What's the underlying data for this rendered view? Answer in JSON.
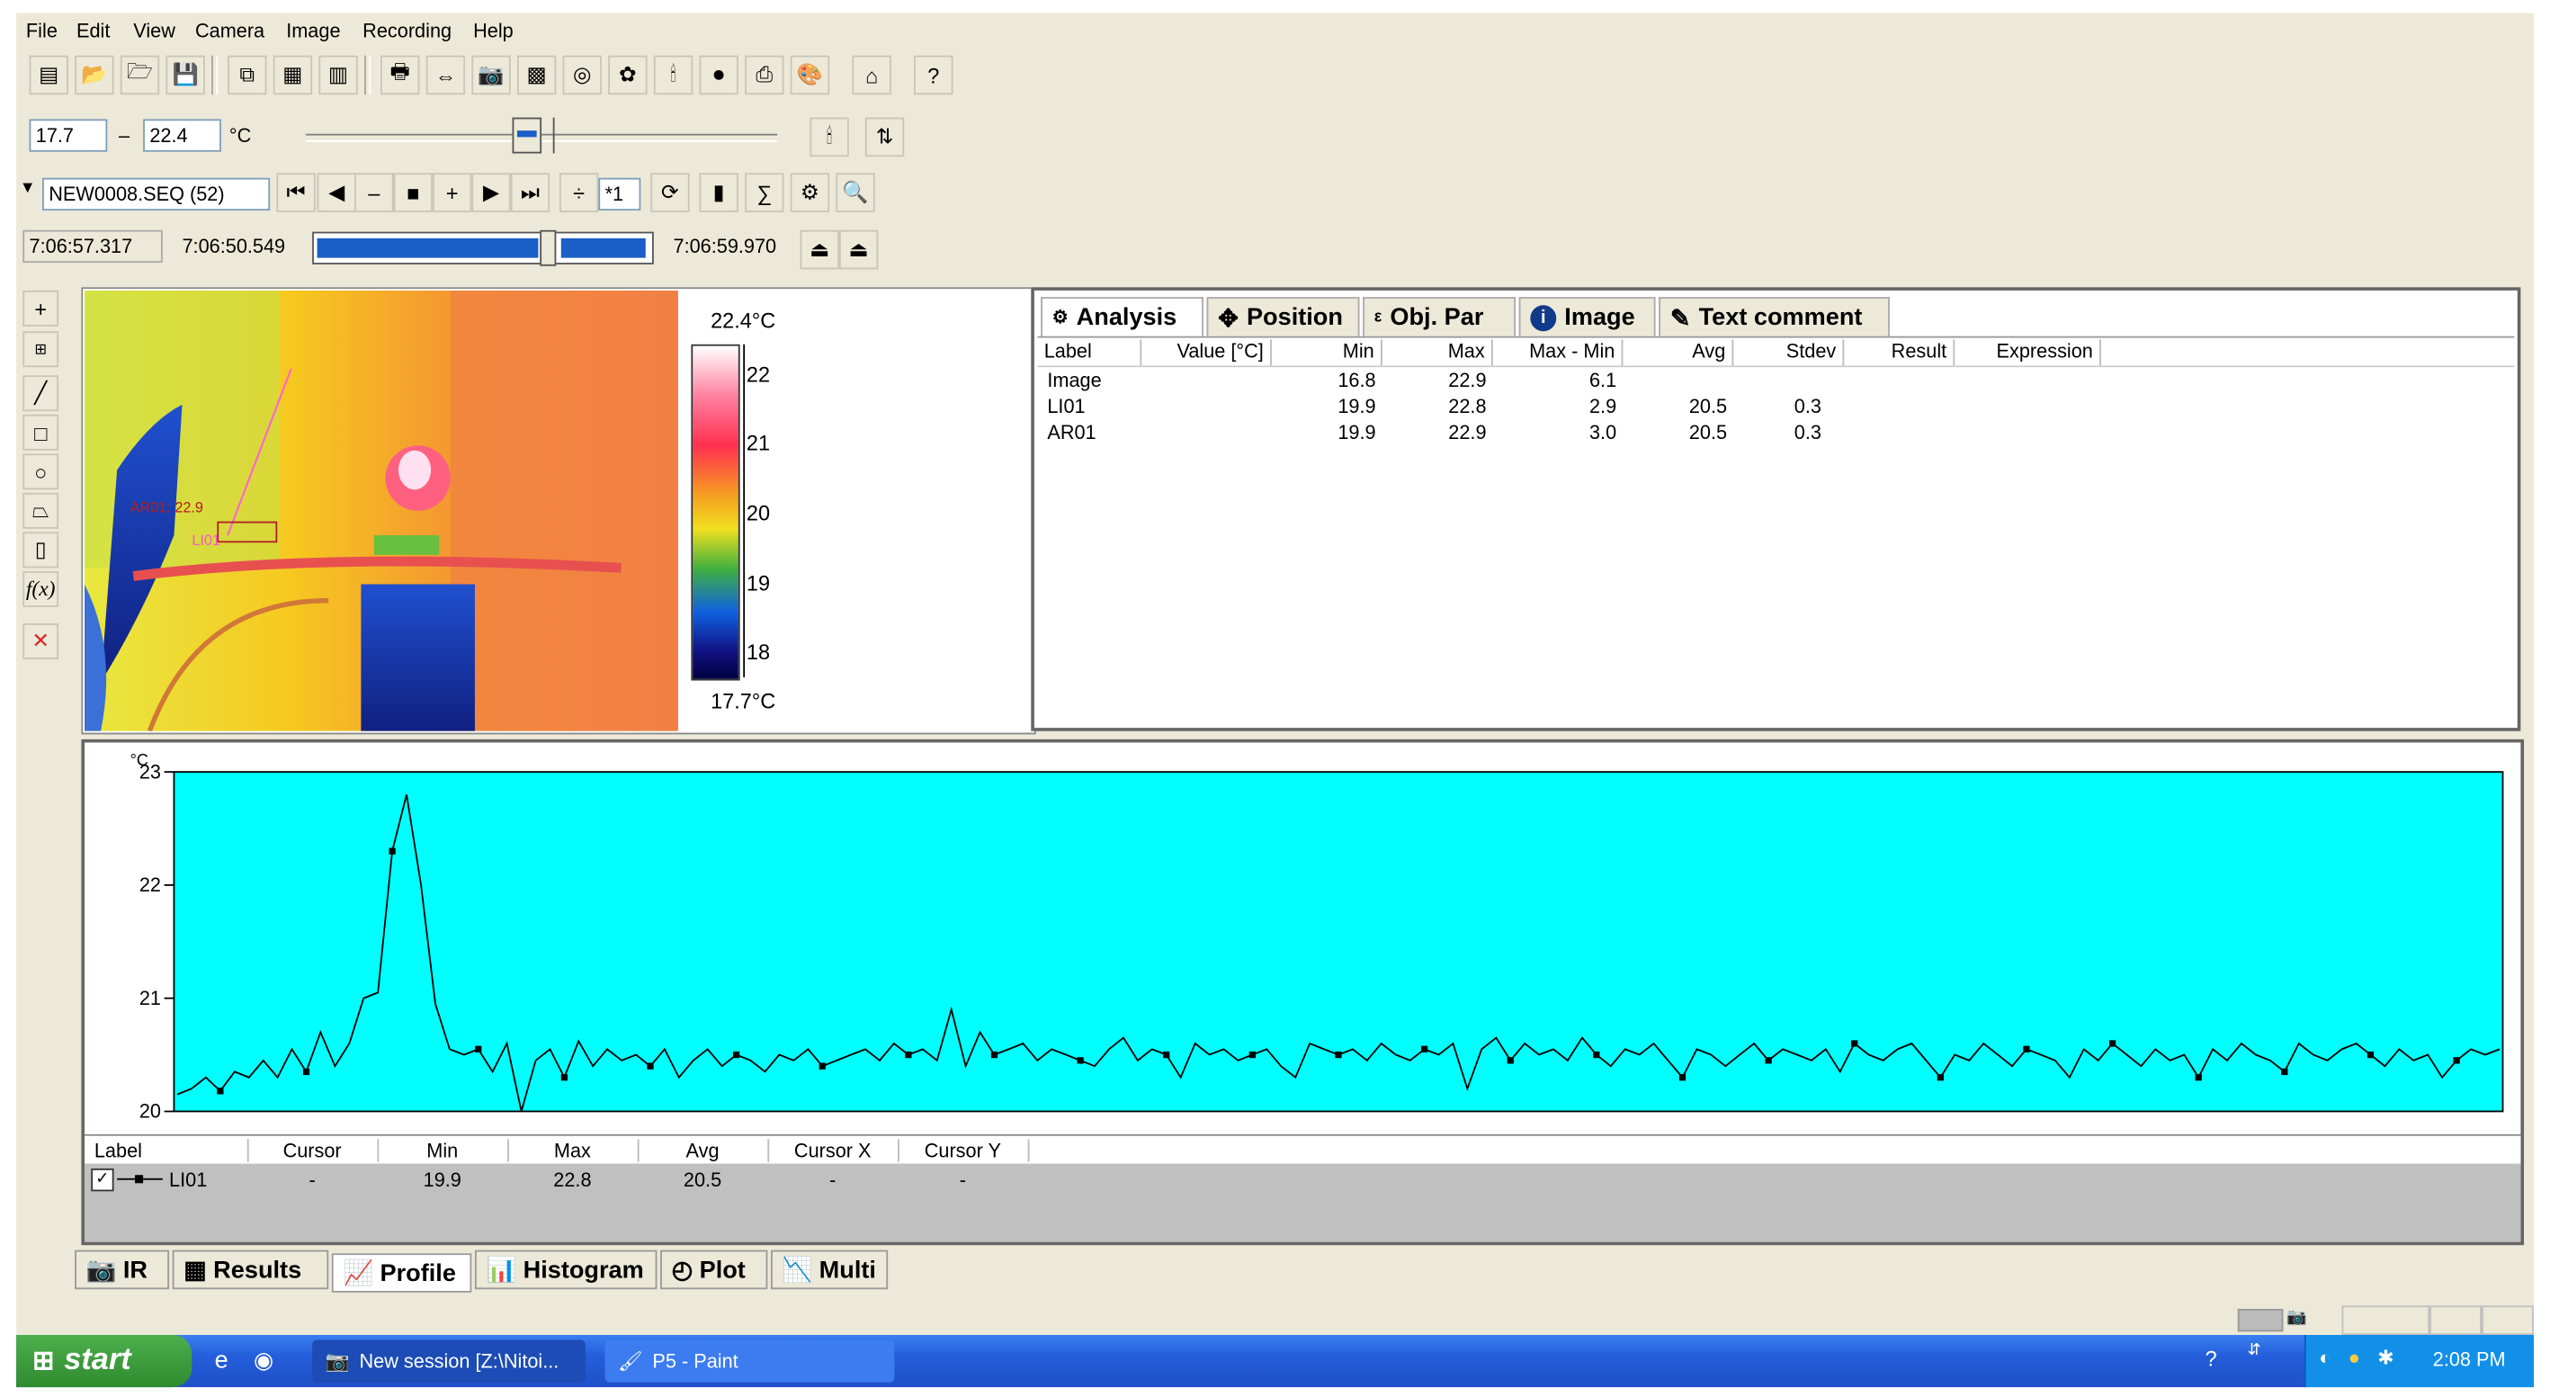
{
  "menu": [
    "File",
    "Edit",
    "View",
    "Camera",
    "Image",
    "Recording",
    "Help"
  ],
  "range": {
    "low": "17.7",
    "dash": "–",
    "high": "22.4",
    "unit": "°C"
  },
  "sequence": {
    "file": "NEW0008.SEQ (52)",
    "speed": "*1"
  },
  "time": {
    "start": "7:06:57.317",
    "current": "7:06:50.549",
    "end": "7:06:59.970"
  },
  "scale": {
    "top_label": "22.4°C",
    "bottom_label": "17.7°C",
    "ticks": [
      "22",
      "21",
      "20",
      "19",
      "18"
    ]
  },
  "ir_overlay": {
    "area_label": "AR01: 22.9",
    "line_label": "LI01"
  },
  "analysis": {
    "tabs": [
      "Analysis",
      "Position",
      "Obj. Par",
      "Image",
      "Text comment"
    ],
    "columns": [
      "Label",
      "Value [°C]",
      "Min",
      "Max",
      "Max - Min",
      "Avg",
      "Stdev",
      "Result",
      "Expression"
    ],
    "rows": [
      {
        "label": "Image",
        "min": "16.8",
        "max": "22.9",
        "range": "6.1",
        "avg": "",
        "stdev": ""
      },
      {
        "label": "LI01",
        "min": "19.9",
        "max": "22.8",
        "range": "2.9",
        "avg": "20.5",
        "stdev": "0.3"
      },
      {
        "label": "AR01",
        "min": "19.9",
        "max": "22.9",
        "range": "3.0",
        "avg": "20.5",
        "stdev": "0.3"
      }
    ]
  },
  "chart_data": {
    "type": "line",
    "ylabel": "°C",
    "ylim": [
      20,
      23
    ],
    "yticks": [
      "23",
      "22",
      "21",
      "20"
    ],
    "series": [
      {
        "name": "LI01",
        "values": [
          20.15,
          20.2,
          20.3,
          20.18,
          20.35,
          20.3,
          20.45,
          20.3,
          20.55,
          20.35,
          20.7,
          20.4,
          20.6,
          21.0,
          21.05,
          22.3,
          22.8,
          22.0,
          20.95,
          20.55,
          20.5,
          20.55,
          20.35,
          20.6,
          20.0,
          20.45,
          20.55,
          20.3,
          20.62,
          20.4,
          20.55,
          20.45,
          20.5,
          20.4,
          20.55,
          20.3,
          20.45,
          20.55,
          20.4,
          20.5,
          20.45,
          20.35,
          20.5,
          20.45,
          20.55,
          20.4,
          20.45,
          20.5,
          20.55,
          20.45,
          20.6,
          20.5,
          20.55,
          20.45,
          20.9,
          20.4,
          20.7,
          20.5,
          20.55,
          20.6,
          20.45,
          20.55,
          20.5,
          20.45,
          20.4,
          20.55,
          20.65,
          20.45,
          20.55,
          20.5,
          20.3,
          20.6,
          20.5,
          20.55,
          20.45,
          20.5,
          20.55,
          20.4,
          20.3,
          20.6,
          20.55,
          20.5,
          20.55,
          20.45,
          20.6,
          20.5,
          20.45,
          20.55,
          20.5,
          20.6,
          20.2,
          20.55,
          20.65,
          20.45,
          20.6,
          20.5,
          20.55,
          20.45,
          20.65,
          20.5,
          20.4,
          20.55,
          20.5,
          20.6,
          20.45,
          20.3,
          20.55,
          20.5,
          20.4,
          20.5,
          20.6,
          20.45,
          20.55,
          20.5,
          20.45,
          20.55,
          20.35,
          20.6,
          20.5,
          20.45,
          20.55,
          20.6,
          20.45,
          20.3,
          20.5,
          20.45,
          20.6,
          20.5,
          20.4,
          20.55,
          20.5,
          20.45,
          20.3,
          20.55,
          20.45,
          20.6,
          20.5,
          20.4,
          20.55,
          20.45,
          20.5,
          20.3,
          20.55,
          20.45,
          20.6,
          20.5,
          20.45,
          20.35,
          20.6,
          20.5,
          20.45,
          20.55,
          20.6,
          20.5,
          20.4,
          20.55,
          20.45,
          20.5,
          20.3,
          20.45,
          20.55,
          20.5,
          20.55
        ]
      }
    ]
  },
  "legend_table": {
    "columns": [
      "Label",
      "Cursor",
      "Min",
      "Max",
      "Avg",
      "Cursor X",
      "Cursor Y"
    ],
    "row": {
      "label": "LI01",
      "cursor": "-",
      "min": "19.9",
      "max": "22.8",
      "avg": "20.5",
      "cursor_x": "-",
      "cursor_y": "-"
    }
  },
  "bottom_tabs": [
    "IR",
    "Results",
    "Profile",
    "Histogram",
    "Plot",
    "Multi"
  ],
  "taskbar": {
    "start": "start",
    "task1": "New session [Z:\\Nitoi...",
    "task2": "P5 - Paint",
    "clock": "2:08 PM"
  },
  "colors": {
    "plot_bg": "#00ffff",
    "taskbar": "#245edb",
    "start": "#3a9a3a"
  }
}
